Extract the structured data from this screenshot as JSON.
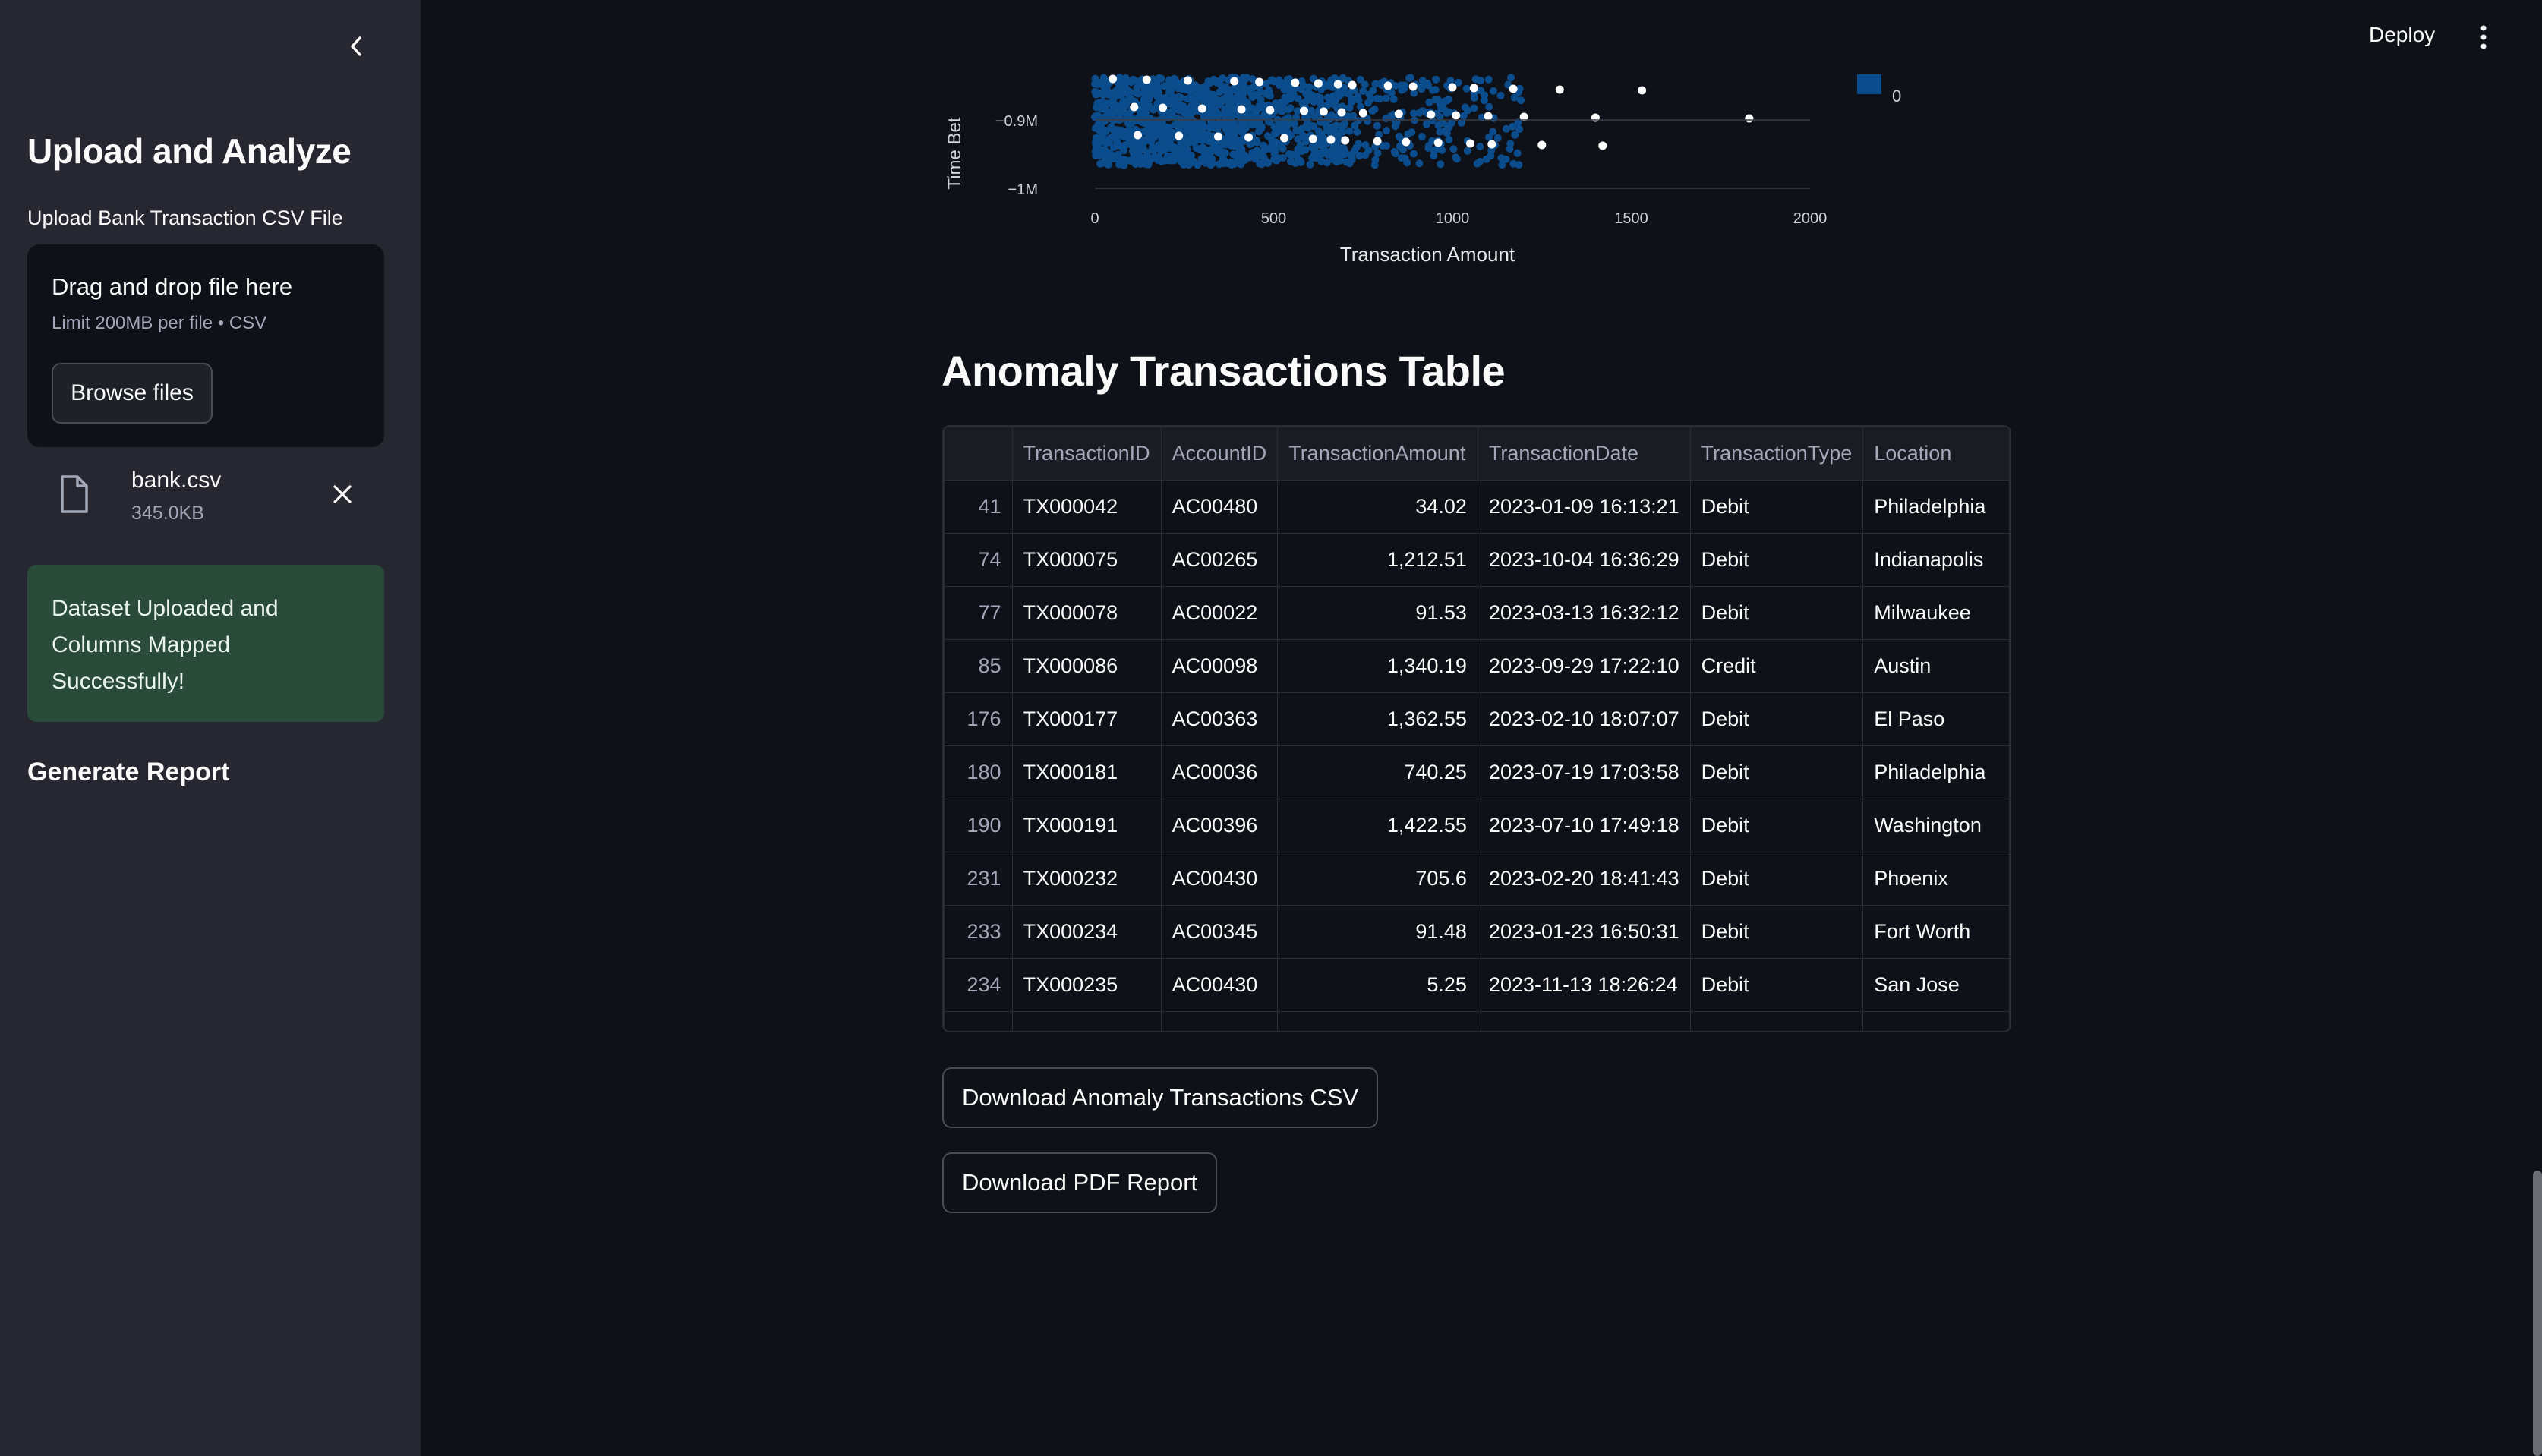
{
  "header": {
    "deploy_label": "Deploy"
  },
  "sidebar": {
    "title": "Upload and Analyze",
    "upload_label": "Upload Bank Transaction CSV File",
    "dropzone": {
      "title": "Drag and drop file here",
      "limit": "Limit 200MB per file • CSV",
      "browse_label": "Browse files"
    },
    "file": {
      "name": "bank.csv",
      "size": "345.0KB"
    },
    "success_message": "Dataset Uploaded and Columns Mapped Successfully!",
    "generate_report": "Generate Report"
  },
  "chart_data": {
    "type": "scatter",
    "xlabel": "Transaction Amount",
    "ylabel": "Time Bet",
    "x_ticks": [
      "0",
      "500",
      "1000",
      "1500",
      "2000"
    ],
    "y_ticks": [
      "−0.9M",
      "−1M"
    ],
    "xlim": [
      0,
      2000
    ],
    "legend": {
      "entries": [
        "0"
      ],
      "color": "#0b4c8c",
      "placement": "right"
    },
    "series_colors": {
      "normal": "#0b4c8c",
      "anomaly": "#ffffff"
    },
    "anomaly_points_x": [
      50,
      110,
      120,
      145,
      190,
      235,
      260,
      300,
      345,
      390,
      410,
      430,
      460,
      490,
      530,
      560,
      585,
      610,
      625,
      640,
      660,
      680,
      690,
      700,
      720,
      750,
      790,
      820,
      850,
      870,
      890,
      940,
      960,
      1000,
      1010,
      1050,
      1060,
      1100,
      1110,
      1170,
      1200,
      1250,
      1300,
      1400,
      1420,
      1530,
      1830
    ]
  },
  "main": {
    "table_title": "Anomaly Transactions Table",
    "table": {
      "columns": [
        "",
        "TransactionID",
        "AccountID",
        "TransactionAmount",
        "TransactionDate",
        "TransactionType",
        "Location"
      ],
      "rows": [
        [
          "41",
          "TX000042",
          "AC00480",
          "34.02",
          "2023-01-09 16:13:21",
          "Debit",
          "Philadelphia"
        ],
        [
          "74",
          "TX000075",
          "AC00265",
          "1,212.51",
          "2023-10-04 16:36:29",
          "Debit",
          "Indianapolis"
        ],
        [
          "77",
          "TX000078",
          "AC00022",
          "91.53",
          "2023-03-13 16:32:12",
          "Debit",
          "Milwaukee"
        ],
        [
          "85",
          "TX000086",
          "AC00098",
          "1,340.19",
          "2023-09-29 17:22:10",
          "Credit",
          "Austin"
        ],
        [
          "176",
          "TX000177",
          "AC00363",
          "1,362.55",
          "2023-02-10 18:07:07",
          "Debit",
          "El Paso"
        ],
        [
          "180",
          "TX000181",
          "AC00036",
          "740.25",
          "2023-07-19 17:03:58",
          "Debit",
          "Philadelphia"
        ],
        [
          "190",
          "TX000191",
          "AC00396",
          "1,422.55",
          "2023-07-10 17:49:18",
          "Debit",
          "Washington"
        ],
        [
          "231",
          "TX000232",
          "AC00430",
          "705.6",
          "2023-02-20 18:41:43",
          "Debit",
          "Phoenix"
        ],
        [
          "233",
          "TX000234",
          "AC00345",
          "91.48",
          "2023-01-23 16:50:31",
          "Debit",
          "Fort Worth"
        ],
        [
          "234",
          "TX000235",
          "AC00430",
          "5.25",
          "2023-11-13 18:26:24",
          "Debit",
          "San Jose"
        ]
      ]
    },
    "download_csv_label": "Download Anomaly Transactions CSV",
    "download_pdf_label": "Download PDF Report"
  }
}
